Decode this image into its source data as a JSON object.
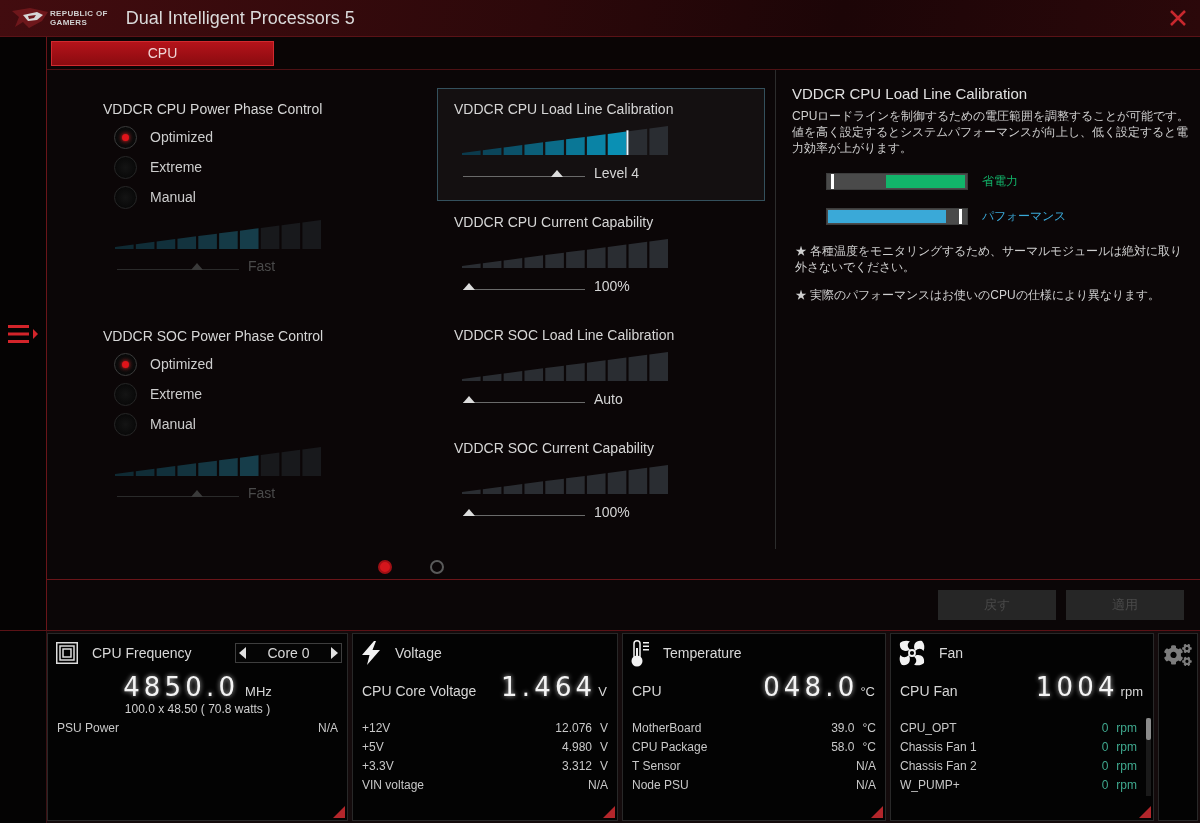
{
  "window": {
    "logo_lines": [
      "REPUBLIC OF",
      "GAMERS"
    ],
    "title": "Dual Intelligent Processors 5"
  },
  "tabs": [
    {
      "label": "CPU",
      "selected": true
    }
  ],
  "phase_controls": [
    {
      "title": "VDDCR CPU Power Phase Control",
      "options": [
        {
          "label": "Optimized",
          "selected": true
        },
        {
          "label": "Extreme",
          "selected": false
        },
        {
          "label": "Manual",
          "selected": false
        }
      ],
      "slider": {
        "level": 0.67,
        "value": "Fast",
        "disabled": true
      }
    },
    {
      "title": "VDDCR SOC Power Phase Control",
      "options": [
        {
          "label": "Optimized",
          "selected": true
        },
        {
          "label": "Extreme",
          "selected": false
        },
        {
          "label": "Manual",
          "selected": false
        }
      ],
      "slider": {
        "level": 0.67,
        "value": "Fast",
        "disabled": true
      }
    }
  ],
  "calibrations": [
    {
      "title": "VDDCR CPU Load Line Calibration",
      "selected": true,
      "slider": {
        "level": 0.8,
        "value": "Level 4",
        "disabled": false
      }
    },
    {
      "title": "VDDCR CPU Current Capability",
      "selected": false,
      "slider": {
        "level": 0,
        "value": "100%",
        "disabled": false
      }
    },
    {
      "title": "VDDCR SOC Load Line Calibration",
      "selected": false,
      "slider": {
        "level": 0,
        "value": "Auto",
        "disabled": false
      }
    },
    {
      "title": "VDDCR SOC Current Capability",
      "selected": false,
      "slider": {
        "level": 0,
        "value": "100%",
        "disabled": false
      }
    }
  ],
  "pages": [
    {
      "selected": true
    },
    {
      "selected": false
    }
  ],
  "help": {
    "title": "VDDCR CPU Load Line Calibration",
    "description": "CPUロードラインを制御するための電圧範囲を調整することが可能です。値を高く設定するとシステムパフォーマンスが向上し、低く設定すると電力効率が上がります。",
    "legend": [
      {
        "kind": "saving",
        "label": "省電力",
        "color": "#12b46a"
      },
      {
        "kind": "performance",
        "label": "パフォーマンス",
        "color": "#3aa9d8"
      }
    ],
    "notes": [
      "★ 各種温度をモニタリングするため、サーマルモジュールは絶対に取り外さないでください。",
      "★ 実際のパフォーマンスはお使いのCPUの仕様により異なります。"
    ]
  },
  "buttons": [
    {
      "label": "戻す",
      "disabled": true
    },
    {
      "label": "適用",
      "disabled": true
    }
  ],
  "monitor": [
    {
      "kind": "frequency",
      "title": "CPU Frequency",
      "selector": "Core 0",
      "main_value": "4850.0",
      "main_unit": "MHz",
      "detail": "100.0 x 48.50 ( 70.8 watts )",
      "rows": [
        {
          "label": "PSU Power",
          "value": "N/A"
        }
      ]
    },
    {
      "kind": "voltage",
      "title": "Voltage",
      "main_label": "CPU Core Voltage",
      "main_value": "1.464",
      "main_unit": "V",
      "rows": [
        {
          "label": "+12V",
          "value": "12.076",
          "unit": "V"
        },
        {
          "label": "+5V",
          "value": "4.980",
          "unit": "V"
        },
        {
          "label": "+3.3V",
          "value": "3.312",
          "unit": "V"
        },
        {
          "label": "VIN voltage",
          "value": "N/A"
        }
      ]
    },
    {
      "kind": "temperature",
      "title": "Temperature",
      "main_label": "CPU",
      "main_value": "048.0",
      "main_unit": "°C",
      "rows": [
        {
          "label": "MotherBoard",
          "value": "39.0",
          "unit": "°C"
        },
        {
          "label": "CPU Package",
          "value": "58.0",
          "unit": "°C"
        },
        {
          "label": "T Sensor",
          "value": "N/A"
        },
        {
          "label": "Node PSU",
          "value": "N/A"
        }
      ]
    },
    {
      "kind": "fan",
      "title": "Fan",
      "main_label": "CPU Fan",
      "main_value": "1004",
      "main_unit": "rpm",
      "rows": [
        {
          "label": "CPU_OPT",
          "value": "0",
          "unit": "rpm"
        },
        {
          "label": "Chassis Fan 1",
          "value": "0",
          "unit": "rpm"
        },
        {
          "label": "Chassis Fan 2",
          "value": "0",
          "unit": "rpm"
        },
        {
          "label": "W_PUMP+",
          "value": "0",
          "unit": "rpm"
        }
      ]
    }
  ]
}
